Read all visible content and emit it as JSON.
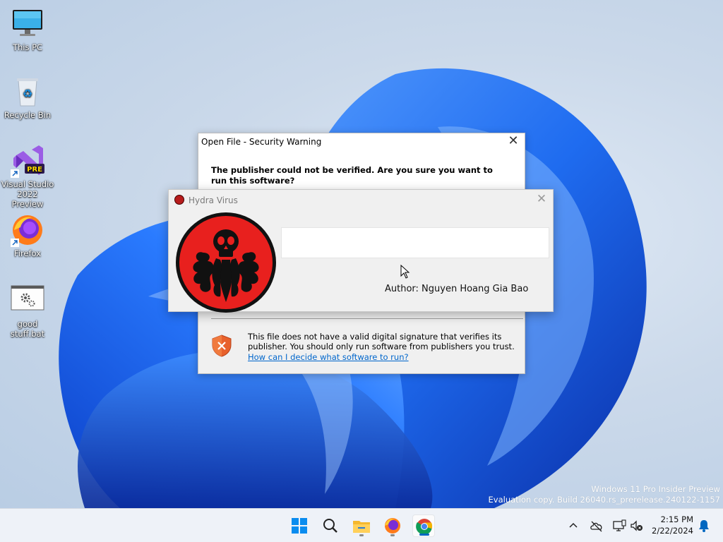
{
  "desktop": {
    "icons": [
      {
        "label": "This PC",
        "icon": "computer-icon"
      },
      {
        "label": "Recycle Bin",
        "icon": "recycle-bin-icon"
      },
      {
        "label": "Visual Studio 2022 Preview",
        "icon": "visual-studio-icon",
        "badge": "PRE"
      },
      {
        "label": "Firefox",
        "icon": "firefox-icon"
      },
      {
        "label": "good stuff.bat",
        "icon": "batch-file-icon"
      }
    ],
    "watermark": {
      "line1": "Windows 11 Pro Insider Preview",
      "line2": "Evaluation copy. Build 26040.rs_prerelease.240122-1157"
    }
  },
  "security_dialog": {
    "title": "Open File - Security Warning",
    "question": "The publisher could not be verified.  Are you sure you want to run this software?",
    "warning_text": "This file does not have a valid digital signature that verifies its publisher.  You should only run software from publishers you trust.",
    "link": "How can I decide what software to run?"
  },
  "hydra_window": {
    "title": "Hydra Virus",
    "textbox_value": "",
    "author": "Author: Nguyen Hoang Gia Bao"
  },
  "taskbar": {
    "icons": [
      "windows-start-icon",
      "search-icon",
      "file-explorer-icon",
      "firefox-icon",
      "chrome-icon"
    ],
    "tray_icons": [
      "chevron-up-icon",
      "onedrive-offline-icon",
      "network-icon",
      "volume-muted-icon",
      "notifications-bell-icon"
    ],
    "time": "2:15 PM",
    "date": "2/22/2024"
  },
  "colors": {
    "accent": "#0067c0",
    "link": "#0066cc",
    "hydra_red": "#e8201e",
    "shield_orange": "#e8612c"
  }
}
